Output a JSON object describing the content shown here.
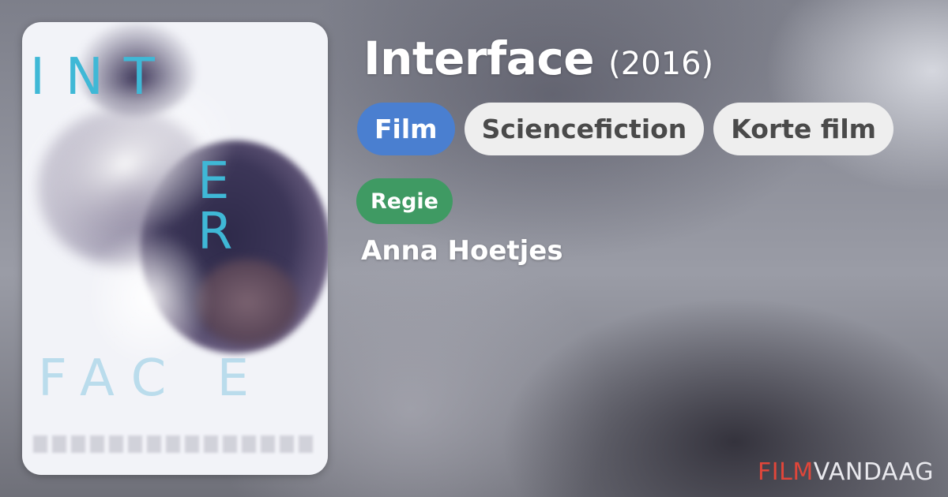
{
  "colors": {
    "tag_primary_bg": "#4a7fd0",
    "tag_secondary_bg": "#eeeeee",
    "role_badge_bg": "#3f9a63",
    "brand_red": "#e0463a",
    "brand_light": "#e9e9ee"
  },
  "poster": {
    "letters": [
      "I",
      "N",
      "T",
      "E",
      "R",
      "F",
      "A",
      "C",
      "E"
    ],
    "row1": "INT",
    "row2": "E R",
    "row3": "FAC E"
  },
  "movie": {
    "title": "Interface",
    "year": "(2016)"
  },
  "tags": [
    {
      "label": "Film",
      "primary": true
    },
    {
      "label": "Sciencefiction",
      "primary": false
    },
    {
      "label": "Korte film",
      "primary": false
    }
  ],
  "credits": {
    "role": "Regie",
    "person": "Anna Hoetjes"
  },
  "brand": {
    "part1": "FILM",
    "part2": "VANDAAG"
  }
}
